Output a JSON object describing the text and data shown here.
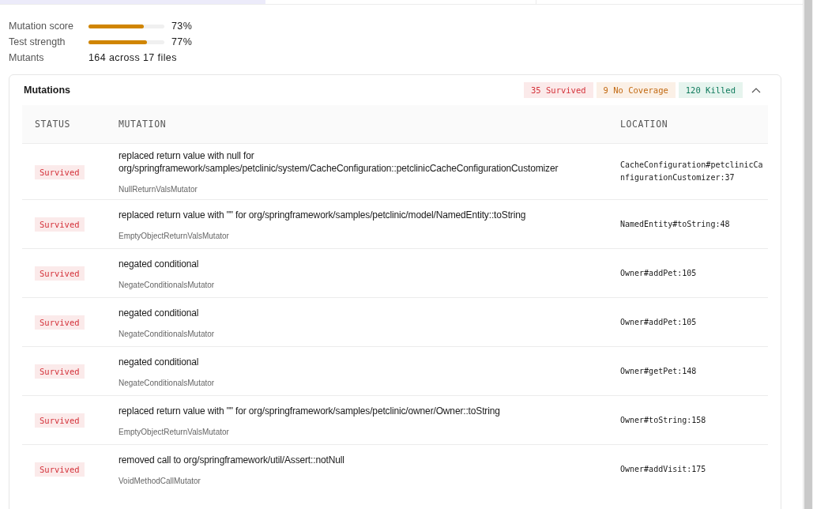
{
  "stats": [
    {
      "label": "Mutation score",
      "level": 0.73,
      "value": "73%"
    },
    {
      "label": "Test strength",
      "level": 0.77,
      "value": "77%"
    }
  ],
  "mutants": {
    "label": "Mutants",
    "value": "164 across 17 files"
  },
  "mutations_panel": {
    "title": "Mutations",
    "expanded": true,
    "summary": [
      {
        "kind": "survived",
        "text": "35 Survived"
      },
      {
        "kind": "no_coverage",
        "text": "9 No Coverage"
      },
      {
        "kind": "killed",
        "text": "120 Killed"
      }
    ],
    "columns": [
      "STATUS",
      "MUTATION",
      "LOCATION"
    ],
    "rows": [
      {
        "status": "Survived",
        "kind": "survived",
        "mutation": [
          "replaced return value with null for",
          "org/springframework/samples/petclinic/system/CacheConfiguration::petclinicCacheConfigurationCustomizer"
        ],
        "mutator": "NullReturnValsMutator",
        "location": [
          "CacheConfiguration#petclinicCa",
          "nfigurationCustomizer:37"
        ]
      },
      {
        "status": "Survived",
        "kind": "survived",
        "mutation": [
          "replaced return value with \"\" for org/springframework/samples/petclinic/model/NamedEntity::toString"
        ],
        "mutator": "EmptyObjectReturnValsMutator",
        "location": [
          "NamedEntity#toString:48"
        ]
      },
      {
        "status": "Survived",
        "kind": "survived",
        "mutation": [
          "negated conditional"
        ],
        "mutator": "NegateConditionalsMutator",
        "location": [
          "Owner#addPet:105"
        ]
      },
      {
        "status": "Survived",
        "kind": "survived",
        "mutation": [
          "negated conditional"
        ],
        "mutator": "NegateConditionalsMutator",
        "location": [
          "Owner#addPet:105"
        ]
      },
      {
        "status": "Survived",
        "kind": "survived",
        "mutation": [
          "negated conditional"
        ],
        "mutator": "NegateConditionalsMutator",
        "location": [
          "Owner#getPet:148"
        ]
      },
      {
        "status": "Survived",
        "kind": "survived",
        "mutation": [
          "replaced return value with \"\" for org/springframework/samples/petclinic/owner/Owner::toString"
        ],
        "mutator": "EmptyObjectReturnValsMutator",
        "location": [
          "Owner#toString:158"
        ]
      },
      {
        "status": "Survived",
        "kind": "survived",
        "mutation": [
          "removed call to org/springframework/util/Assert::notNull"
        ],
        "mutator": "VoidMethodCallMutator",
        "location": [
          "Owner#addVisit:175"
        ]
      }
    ]
  }
}
